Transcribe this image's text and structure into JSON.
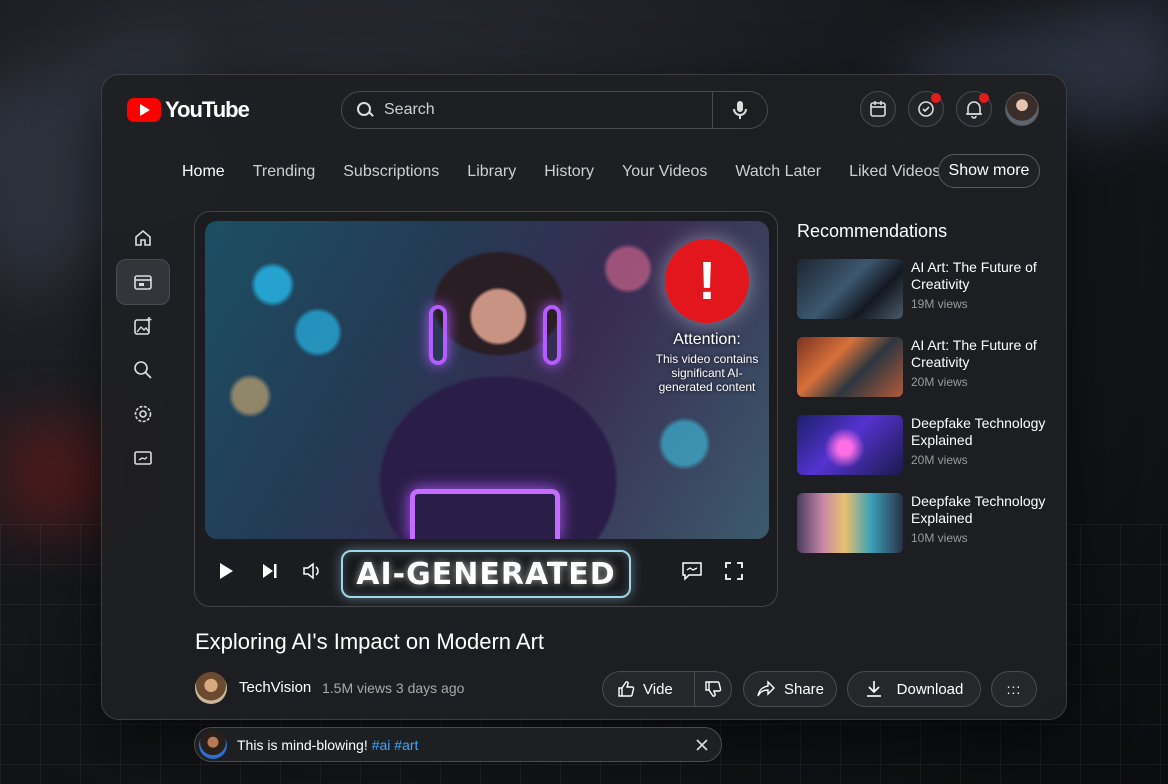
{
  "brand": {
    "name": "YouTube",
    "accent": "#ff0000"
  },
  "search": {
    "placeholder": "Search"
  },
  "header_icons": [
    "calendar-icon",
    "sync-notify-icon",
    "bell-icon",
    "profile-avatar"
  ],
  "nav": {
    "items": [
      "Home",
      "Trending",
      "Subscriptions",
      "Library",
      "History",
      "Your Videos",
      "Watch Later",
      "Liked Videos"
    ],
    "active": "Home",
    "show_more": "Show more"
  },
  "rail": [
    "home-icon",
    "subscriptions-icon",
    "add-image-icon",
    "search-icon",
    "settings-icon",
    "monitor-icon"
  ],
  "player": {
    "alert_symbol": "!",
    "attention_title": "Attention:",
    "attention_body": "This video contains significant AI-generated content",
    "badge": "AI-GENERATED"
  },
  "video": {
    "title": "Exploring AI's Impact on Modern Art",
    "channel": "TechVision",
    "views": "1.5M views",
    "age": "3 days ago",
    "like_label": "Vide",
    "share_label": "Share",
    "download_label": "Download",
    "more_label": ":::"
  },
  "recommendations": {
    "heading": "Recommendations",
    "items": [
      {
        "title": "AI Art: The Future of Creativity",
        "views": "19M views"
      },
      {
        "title": "AI Art: The Future of Creativity",
        "views": "20M views"
      },
      {
        "title": "Deepfake Technology Explained",
        "views": "20M views"
      },
      {
        "title": "Deepfake Technology Explained",
        "views": "10M views"
      }
    ]
  },
  "comment": {
    "text": "This is mind-blowing!",
    "tags": "#ai #art"
  }
}
